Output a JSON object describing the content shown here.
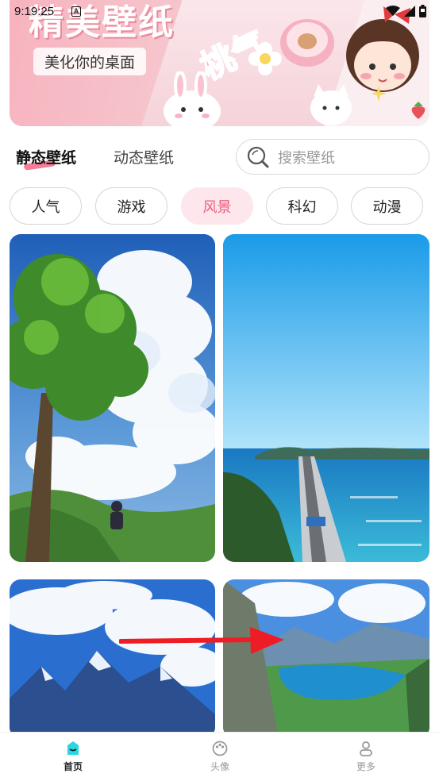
{
  "status_bar": {
    "time": "9:19:25",
    "icons": [
      "notification-a-icon",
      "wifi-icon",
      "signal-icon",
      "battery-icon"
    ]
  },
  "banner": {
    "title": "精美壁纸",
    "subtitle": "美化你的桌面"
  },
  "tabs": [
    {
      "label": "静态壁纸",
      "active": true
    },
    {
      "label": "动态壁纸",
      "active": false
    }
  ],
  "search": {
    "placeholder": "搜索壁纸",
    "icon": "search-icon"
  },
  "categories": [
    {
      "label": "人气",
      "active": false
    },
    {
      "label": "游戏",
      "active": false
    },
    {
      "label": "风景",
      "active": true
    },
    {
      "label": "科幻",
      "active": false
    },
    {
      "label": "动漫",
      "active": false
    }
  ],
  "wallpapers": [
    {
      "subject": "tree-clouds-sky"
    },
    {
      "subject": "sea-bridge"
    },
    {
      "subject": "snow-mountains-sky"
    },
    {
      "subject": "valley-lake"
    }
  ],
  "bottom_nav": [
    {
      "label": "首页",
      "icon": "home-icon",
      "active": true
    },
    {
      "label": "头像",
      "icon": "palette-icon",
      "active": false
    },
    {
      "label": "更多",
      "icon": "user-icon",
      "active": false
    }
  ],
  "colors": {
    "accent": "#f05a7e",
    "chip_active_bg": "#fde6ec",
    "nav_active": "#2ad6e0"
  }
}
